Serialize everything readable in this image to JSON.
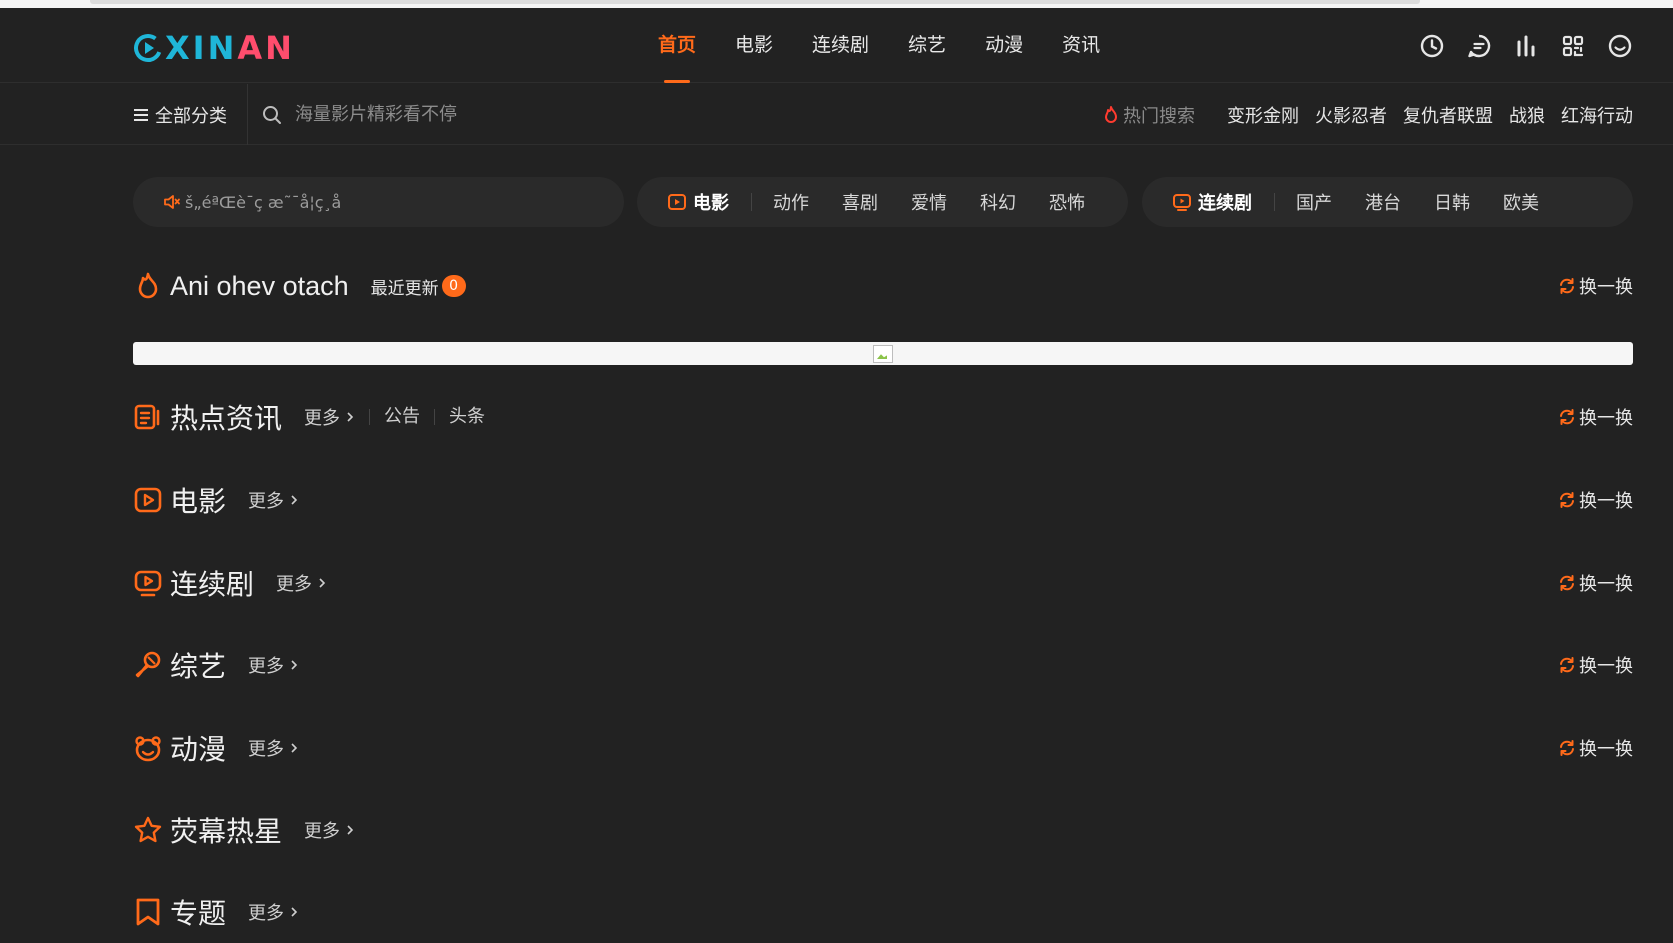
{
  "header": {
    "logo": {
      "part1": "XIN",
      "part2": "AN"
    },
    "nav": [
      {
        "label": "首页",
        "active": true
      },
      {
        "label": "电影",
        "active": false
      },
      {
        "label": "连续剧",
        "active": false
      },
      {
        "label": "综艺",
        "active": false
      },
      {
        "label": "动漫",
        "active": false
      },
      {
        "label": "资讯",
        "active": false
      }
    ],
    "tools": [
      "clock-icon",
      "chat-icon",
      "chart-icon",
      "grid-icon",
      "user-icon"
    ]
  },
  "subbar": {
    "all_categories": "全部分类",
    "search_placeholder": "海量影片精彩看不停",
    "hot_label": "热门搜索",
    "hot_items": [
      "变形金刚",
      "火影忍者",
      "复仇者联盟",
      "战狼",
      "红海行动"
    ]
  },
  "quickbar": {
    "notice": "š„éªŒè¯ç æ˜¯å¦ç¸å",
    "movie": {
      "title": "电影",
      "links": [
        "动作",
        "喜剧",
        "爱情",
        "科幻",
        "恐怖"
      ]
    },
    "tv": {
      "title": "连续剧",
      "links": [
        "国产",
        "港台",
        "日韩",
        "欧美"
      ]
    }
  },
  "sections": {
    "hot": {
      "title": "Ani ohev otach",
      "recent_label": "最近更新",
      "recent_count": "0",
      "swap": "换一换"
    },
    "news": {
      "title": "热点资讯",
      "more": "更多",
      "subs": [
        "公告",
        "头条"
      ],
      "swap": "换一换"
    },
    "movie": {
      "title": "电影",
      "more": "更多",
      "swap": "换一换"
    },
    "tv": {
      "title": "连续剧",
      "more": "更多",
      "swap": "换一换"
    },
    "variety": {
      "title": "综艺",
      "more": "更多",
      "swap": "换一换"
    },
    "anime": {
      "title": "动漫",
      "more": "更多",
      "swap": "换一换"
    },
    "stars": {
      "title": "荧幕热星",
      "more": "更多"
    },
    "topics": {
      "title": "专题",
      "more": "更多"
    }
  },
  "colors": {
    "accent": "#ff6a1a",
    "background": "#222222",
    "logo_blue": "#1fb6d8",
    "logo_pink": "#ff4d6d"
  }
}
